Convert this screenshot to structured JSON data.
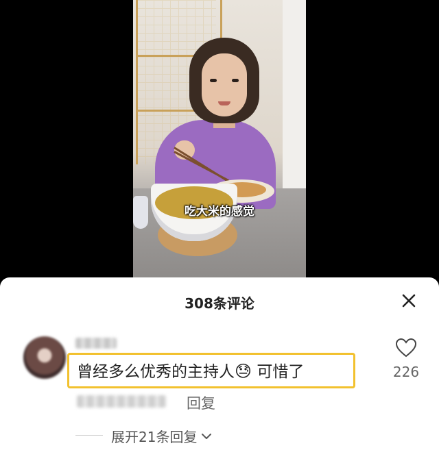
{
  "video": {
    "subtitle": "吃大米的感觉"
  },
  "comments_panel": {
    "title": "308条评论",
    "close_icon": "close-icon"
  },
  "comment": {
    "text": "曾经多么优秀的主持人",
    "emoji": "😓",
    "text_suffix": " 可惜了",
    "likes": "226",
    "reply_label": "回复",
    "expand_label": "展开21条回复",
    "highlight_color": "#f2c12e"
  }
}
